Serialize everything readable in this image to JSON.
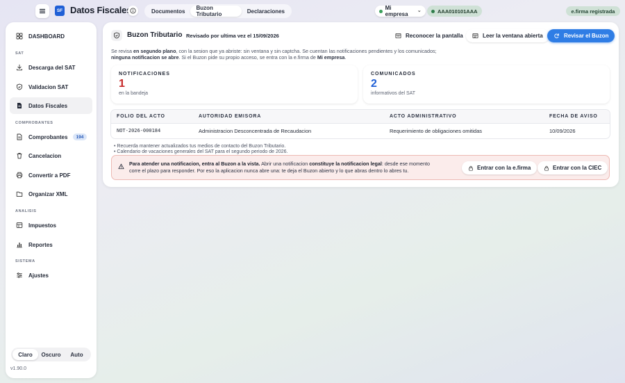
{
  "app": {
    "logo_text": "SF",
    "title": "Datos Fiscales"
  },
  "top_tabs": [
    {
      "label": "Documentos"
    },
    {
      "label": "Buzon Tributario"
    },
    {
      "label": "Declaraciones"
    }
  ],
  "company": {
    "label": "Mi empresa",
    "rfc": "AAA010101AAA"
  },
  "efirma_status": "e.firma registrada",
  "sidebar": {
    "dashboard": "DASHBOARD",
    "sections": {
      "sat": "SAT",
      "comprobantes": "COMPROBANTES",
      "analisis": "ANALISIS",
      "sistema": "SISTEMA"
    },
    "items": [
      {
        "label": "Descarga del SAT",
        "icon": "download-icon"
      },
      {
        "label": "Validacion SAT",
        "icon": "shield-icon"
      },
      {
        "label": "Datos Fiscales",
        "icon": "document-icon"
      },
      {
        "label": "Comprobantes",
        "icon": "file-icon",
        "badge": "194"
      },
      {
        "label": "Cancelacion",
        "icon": "trash-icon"
      },
      {
        "label": "Convertir a PDF",
        "icon": "printer-icon"
      },
      {
        "label": "Organizar XML",
        "icon": "folder-icon"
      },
      {
        "label": "Impuestos",
        "icon": "table-icon"
      },
      {
        "label": "Reportes",
        "icon": "bar-chart-icon"
      },
      {
        "label": "Ajustes",
        "icon": "sliders-icon"
      }
    ],
    "theme": {
      "options": [
        "Claro",
        "Oscuro",
        "Auto"
      ],
      "selected": "Claro"
    },
    "version": "v1.90.0"
  },
  "buzon": {
    "title": "Buzon Tributario",
    "reviewed": "Revisado por ultima vez el 15/09/2026",
    "buttons": {
      "reconocer": "Reconocer la pantalla",
      "leer": "Leer la ventana abierta",
      "revisar": "Revisar el Buzon"
    },
    "intro": {
      "p1": "Se revisa ",
      "b1": "en segundo plano",
      "p2": ", con la sesion que ya abriste: sin ventana y sin captcha. Se cuentan las notificaciones pendientes y los comunicados;",
      "b2": "ninguna notificacion se abre",
      "p3": ". Si el Buzon pide su propio acceso, se entra con la e.firma de ",
      "b3": "Mi empresa",
      "p4": "."
    },
    "stats": {
      "notificaciones": {
        "label": "NOTIFICACIONES",
        "value": "1",
        "sub": "en la bandeja",
        "color": "#c62828"
      },
      "comunicados": {
        "label": "COMUNICADOS",
        "value": "2",
        "sub": "informativos del SAT",
        "color": "#1f5fd6"
      }
    },
    "table": {
      "headers": [
        "FOLIO DEL ACTO",
        "AUTORIDAD EMISORA",
        "ACTO ADMINISTRATIVO",
        "FECHA DE AVISO"
      ],
      "rows": [
        [
          "NOT-2026-000184",
          "Administracion Desconcentrada de Recaudacion",
          "Requerimiento de obligaciones omitidas",
          "10/09/2026"
        ]
      ]
    },
    "notes": [
      "Recuerda mantener actualizados tus medios de contacto del Buzon Tributario.",
      "Calendario de vacaciones generales del SAT para el segundo periodo de 2026."
    ],
    "alert": {
      "b1": "Para atender una notificacion, entra al Buzon a la vista.",
      "p1": " Abrir una notificacion ",
      "b2": "constituye la notificacion legal",
      "p2": ": desde ese momento",
      "line2": "corre el plazo para responder. Por eso la aplicacion nunca abre una: te deja el Buzon abierto y lo que abras dentro lo abres tu.",
      "btn_efirma": "Entrar con la e.firma",
      "btn_ciec": "Entrar con la CIEC"
    }
  }
}
